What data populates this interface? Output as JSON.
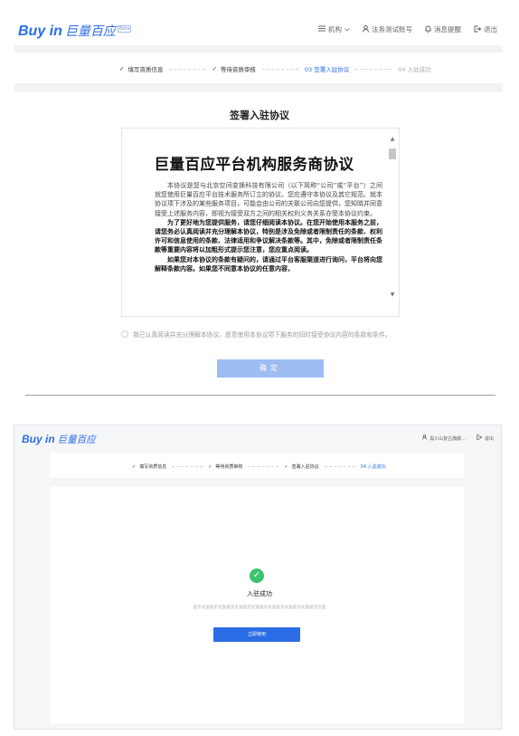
{
  "colors": {
    "brand": "#2b6de5",
    "success": "#3cc46a",
    "disabled_button": "#9dbcf2"
  },
  "logo": {
    "latin": "Buy in",
    "cn": "巨量百应",
    "badge": "Beta"
  },
  "section1": {
    "nav": {
      "org": {
        "icon": "org-icon",
        "label": "机构",
        "caret": "chevron-down-icon"
      },
      "account": {
        "icon": "user-icon",
        "label": "法务测试账号"
      },
      "notice": {
        "icon": "bell-icon",
        "label": "消息提醒"
      },
      "logout": {
        "icon": "logout-icon",
        "label": "退出"
      }
    },
    "steps": [
      {
        "label": "填写资质信息",
        "state": "done"
      },
      {
        "label": "等待资质审核",
        "state": "done"
      },
      {
        "label": "03 签署入驻协议",
        "state": "active"
      },
      {
        "label": "04 入驻成功",
        "state": "pending"
      }
    ],
    "title": "签署入驻协议",
    "document": {
      "heading": "巨量百应平台机构服务商协议",
      "paragraphs": [
        {
          "bold": false,
          "text": "本协议是您与北京空间变换科技有限公司（以下简称“公司”或“平台”）之间就您使用巨量百应平台技术服务所订立的协议。您应遵守本协议及其它规范。就本协议项下涉及的某些服务项目，可能会由公司的关联公司向您提供，您知晓并同意接受上述服务内容，即视为接受双方之间的相关权利义务关系亦受本协议约束。"
        },
        {
          "bold": true,
          "text": "为了更好地为您提供服务，请您仔细阅读本协议。在您开始使用本服务之前，请您务必认真阅读并充分理解本协议，特别是涉及免除或者限制责任的条款、权利许可和信息使用的条款、法律适用和争议解决条款等。其中，免除或者限制责任条款等重要内容将以加粗形式提示您注意，您应重点阅读。"
        },
        {
          "bold": true,
          "text": "如果您对本协议的条款有疑问的，请通过平台客服渠道进行询问，平台将向您解释条款内容。如果您不同意本协议的任意内容，"
        }
      ],
      "scroll_up": "▲",
      "scroll_down": "▼"
    },
    "agreement_text": "我已认真阅读并充分理解本协议，愿意使用本协议项下服务的同时接受协议内容的条款和条件。",
    "confirm_label": "确定"
  },
  "section2": {
    "nav": {
      "account": {
        "icon": "user-icon",
        "label": "黑川山复古旗舰..."
      },
      "logout": {
        "icon": "logout-icon",
        "label": "退出"
      }
    },
    "steps": [
      {
        "label": "填写资质信息",
        "state": "done"
      },
      {
        "label": "等待资质审核",
        "state": "done"
      },
      {
        "label": "签署入驻协议",
        "state": "done"
      },
      {
        "label": "04 入驻成功",
        "state": "active"
      }
    ],
    "success_title": "入驻成功",
    "hint": "提示文案提示文案提示文案提示文案提示文案提示文案提示文案提示文案",
    "start_label": "立即使用"
  }
}
